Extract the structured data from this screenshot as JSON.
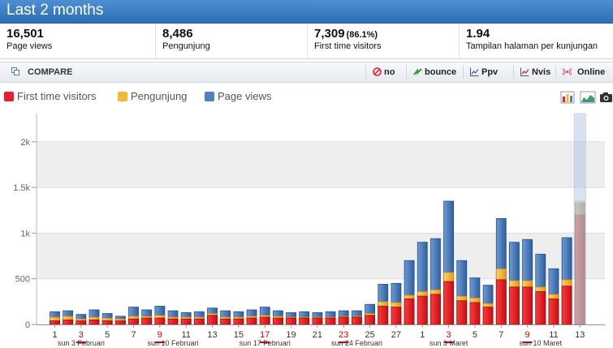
{
  "header": {
    "title": "Last 2 months"
  },
  "stats": [
    {
      "value": "16,501",
      "pct": "",
      "label": "Page views"
    },
    {
      "value": "8,486",
      "pct": "",
      "label": "Pengunjung"
    },
    {
      "value": "7,309",
      "pct": "(86.1%)",
      "label": "First time visitors"
    },
    {
      "value": "1.94",
      "pct": "",
      "label": "Tampilan halaman per kunjungan"
    }
  ],
  "toolbar": {
    "compare_label": "COMPARE",
    "buttons": [
      {
        "label": "no",
        "icon": "no-entry-icon"
      },
      {
        "label": "bounce",
        "icon": "bounce-arrow-icon"
      },
      {
        "label": "Ppv",
        "icon": "line-chart-icon"
      },
      {
        "label": "Nvis",
        "icon": "line-chart-icon"
      },
      {
        "label": "Online",
        "icon": "broadcast-icon"
      }
    ]
  },
  "legend": [
    {
      "label": "First time visitors",
      "color": "#e8202c"
    },
    {
      "label": "Pengunjung",
      "color": "#f7b733"
    },
    {
      "label": "Page views",
      "color": "#4f81bd"
    }
  ],
  "chart_data": {
    "type": "bar",
    "y_ticks": [
      "0",
      "500",
      "1k",
      "1.5k",
      "2k"
    ],
    "ylim": [
      0,
      2300
    ],
    "x_ticks": [
      {
        "label": "1",
        "red": false
      },
      {
        "label": "3",
        "red": true
      },
      {
        "label": "5",
        "red": false
      },
      {
        "label": "7",
        "red": false
      },
      {
        "label": "9",
        "red": true
      },
      {
        "label": "11",
        "red": false
      },
      {
        "label": "13",
        "red": false
      },
      {
        "label": "15",
        "red": false
      },
      {
        "label": "17",
        "red": true
      },
      {
        "label": "19",
        "red": false
      },
      {
        "label": "21",
        "red": false
      },
      {
        "label": "23",
        "red": true
      },
      {
        "label": "25",
        "red": false
      },
      {
        "label": "27",
        "red": false
      },
      {
        "label": "1",
        "red": false
      },
      {
        "label": "3",
        "red": true
      },
      {
        "label": "5",
        "red": false
      },
      {
        "label": "7",
        "red": false
      },
      {
        "label": "9",
        "red": true
      },
      {
        "label": "11",
        "red": false
      },
      {
        "label": "13",
        "red": false
      }
    ],
    "week_labels": [
      "sun 3 Februari",
      "sun 10 Februari",
      "sun 17 Februari",
      "sun 24 Februari",
      "sun 3 Maret",
      "sun 10 Maret"
    ],
    "series": [
      {
        "name": "Page views",
        "values": [
          140,
          150,
          110,
          160,
          120,
          90,
          190,
          160,
          200,
          150,
          130,
          140,
          180,
          150,
          140,
          160,
          190,
          150,
          130,
          140,
          130,
          140,
          150,
          150,
          220,
          440,
          450,
          700,
          900,
          940,
          1350,
          700,
          510,
          430,
          1160,
          900,
          930,
          770,
          610,
          950,
          1330
        ]
      },
      {
        "name": "Pengunjung",
        "values": [
          80,
          90,
          60,
          80,
          70,
          60,
          90,
          90,
          100,
          80,
          80,
          80,
          120,
          80,
          80,
          90,
          100,
          90,
          80,
          80,
          80,
          80,
          90,
          90,
          120,
          250,
          240,
          320,
          360,
          380,
          570,
          310,
          290,
          230,
          610,
          480,
          480,
          410,
          330,
          490,
          1350
        ]
      },
      {
        "name": "First time visitors",
        "values": [
          40,
          50,
          40,
          50,
          40,
          40,
          60,
          70,
          70,
          60,
          60,
          60,
          100,
          60,
          60,
          70,
          80,
          70,
          70,
          70,
          70,
          70,
          80,
          80,
          100,
          200,
          190,
          280,
          310,
          330,
          470,
          260,
          240,
          190,
          490,
          410,
          410,
          360,
          280,
          420,
          1200
        ]
      }
    ]
  }
}
